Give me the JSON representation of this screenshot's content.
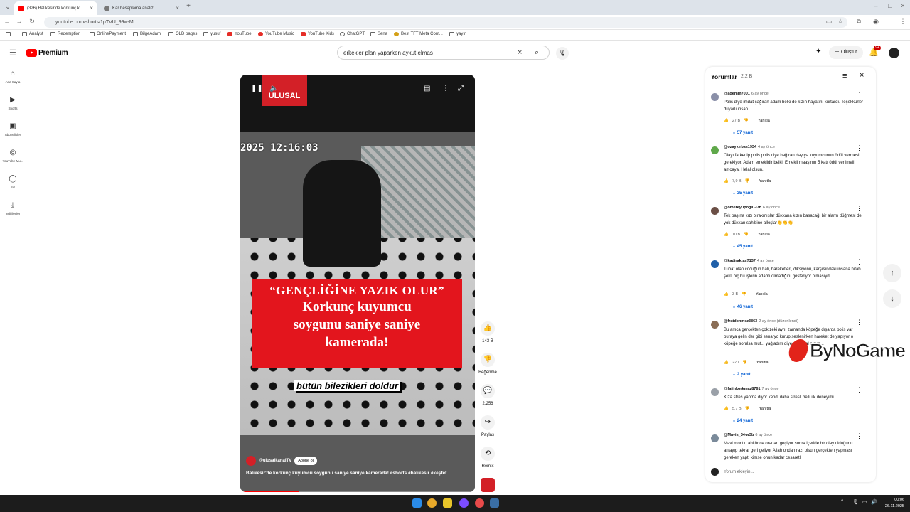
{
  "browser": {
    "tabs": [
      {
        "title": "(326) Balıkesir'de korkunç k",
        "active": true
      },
      {
        "title": "Kar hesaplama analizi",
        "active": false
      }
    ],
    "url": "youtube.com/shorts/1pTVU_99w-M",
    "bookmarks": [
      "Analyst",
      "Redemption",
      "OnlinePayment",
      "BilgeAdam",
      "OLD pages",
      "yusuf",
      "YouTube",
      "YouTube Music",
      "YouTube Kids",
      "ChatGPT",
      "Sena",
      "Best TFT Meta Com...",
      "yayın"
    ]
  },
  "masthead": {
    "logo_text": "Premium",
    "search_query": "erkekler plan yaparken aykut elmas",
    "create_label": "Oluştur",
    "notif_badge": "9+"
  },
  "left_nav": [
    {
      "label": "Ana Sayfa",
      "icon": "home-icon"
    },
    {
      "label": "Shorts",
      "icon": "shorts-icon"
    },
    {
      "label": "Abonelikler",
      "icon": "subscriptions-icon"
    },
    {
      "label": "YouTube Mu...",
      "icon": "youtube-music-icon"
    },
    {
      "label": "Siz",
      "icon": "you-icon"
    },
    {
      "label": "İndirilenler",
      "icon": "downloads-icon"
    }
  ],
  "video": {
    "brand": "ULUSAL",
    "timestamp": "2025 12:16:03",
    "headline_line1": "“GENÇLİĞİNE YAZIK OLUR”",
    "headline_line2": "Korkunç kuyumcu",
    "headline_line3": "soygunu saniye saniye",
    "headline_line4": "kamerada!",
    "caption": "bütün bilezikleri doldur",
    "channel": "@ulusalkanalTV",
    "subscribe_label": "Abone ol",
    "description": "Balıkesir'de korkunç kuyumcu soygunu saniye saniye kamerada! #shorts #balıkesir #keşfet",
    "progress": 0.25
  },
  "actions": {
    "likes": "143 B",
    "dislike_label": "Beğenme",
    "comments": "2.256",
    "share_label": "Paylaş",
    "remix_label": "Remix"
  },
  "comments_panel": {
    "title": "Yorumlar",
    "count": "2,2 B",
    "add_placeholder": "Yorum ekleyin...",
    "reply_label": "Yanıtla",
    "items": [
      {
        "handle": "@ademm7001",
        "time": "6 ay önce",
        "text": "Polis diye imdat çağıran adam belki de kızın hayatını kurtardı. Teşekkürler duyarlı insan",
        "likes": "27 B",
        "replies": "57 yanıt",
        "color": "#8a8fa8"
      },
      {
        "handle": "@ozaykirbas1934",
        "time": "4 ay önce",
        "text": "Olayı farkedip polis polis diye bağıran dayıya kuyumcunun ödül vermesi gerekiyor. Adam emeklidir belki. Emekli maaşının 5 katı ödül verilmeli amcaya. Helal olsun.",
        "likes": "7,9 B",
        "replies": "35 yanıt",
        "color": "#5fa84a"
      },
      {
        "handle": "@ömereyüpoğlu-i7h",
        "time": "6 ay önce",
        "text": "Tek başına kızı bırakmışlar dükkana kızın basacağı bir alarm düğmesi de yok dükkan sahibine alkışlar👏👏👏",
        "likes": "10 B",
        "replies": "45 yanıt",
        "color": "#6b4f46"
      },
      {
        "handle": "@kadiraktas7137",
        "time": "4 ay önce",
        "text": "Tuhaf olan çocuğun hali, hareketleri, diksiyonu, karşısındaki insana hitab şekli hiç bu işlerin adamı olmadığını gösteriyor olmasıydı.",
        "likes": "3 B",
        "replies": "46 yanıt",
        "color": "#1f5fa8"
      },
      {
        "handle": "@fratdonmez3863",
        "time": "2 ay önce (düzenlendi)",
        "text": "Bu amca gerçekten çok zeki aynı zamanda köpeğe dışarda polis var buraya gelin der gibi senaryo kurup seslenirken hareket de yapıyor o köpeğe sorulsa mut... yağladım diyecek helal olsun...",
        "likes": "220",
        "replies": "2 yanıt",
        "color": "#8a6d55"
      },
      {
        "handle": "@fatihkorkmaz8761",
        "time": "7 ay önce",
        "text": "Kıza stres yapma diyor kendi daha stresli belli ilk deneyimi",
        "likes": "5,7 B",
        "replies": "24 yanıt",
        "color": "#9aa0a8"
      },
      {
        "handle": "@Mavis_34-w3b",
        "time": "6 ay önce",
        "text": "Mavi montlu abi önce oradan geçiyor sonra içeride bir olay olduğunu anlayıp tekrar geri geliyor Allah ondan razı olsun gerçekten yapması gereken yaptı kimse onun kadar cesaretli",
        "likes": "",
        "replies": "",
        "color": "#7a8a9a"
      }
    ]
  },
  "watermark": "ByNoGame",
  "taskbar": {
    "time": "00:06",
    "date": "26.11.2025"
  },
  "colors": {
    "accent": "#ff0000",
    "link": "#065fd4",
    "headline_bg": "#e3151d"
  }
}
